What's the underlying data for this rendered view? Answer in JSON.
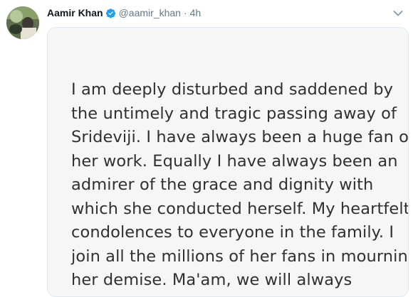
{
  "tweet": {
    "author_name": "Aamir Khan",
    "handle": "@aamir_khan",
    "separator": "·",
    "timestamp": "4h",
    "verified": true,
    "accent_color": "#1da1f2"
  },
  "media": {
    "lines": [
      "I am deeply disturbed and saddened by",
      "the untimely and tragic passing away of",
      "Srideviji. I have always been a huge fan of",
      "her work. Equally I have always been an",
      "admirer of the grace and dignity with",
      "which she conducted herself. My heartfelt",
      "condolences to everyone in the family. I",
      "join all the millions of her fans in mourning",
      "her demise. Ma'am, we will always"
    ]
  },
  "icons": {
    "verified": "verified-badge-icon",
    "caret": "chevron-down-icon"
  }
}
